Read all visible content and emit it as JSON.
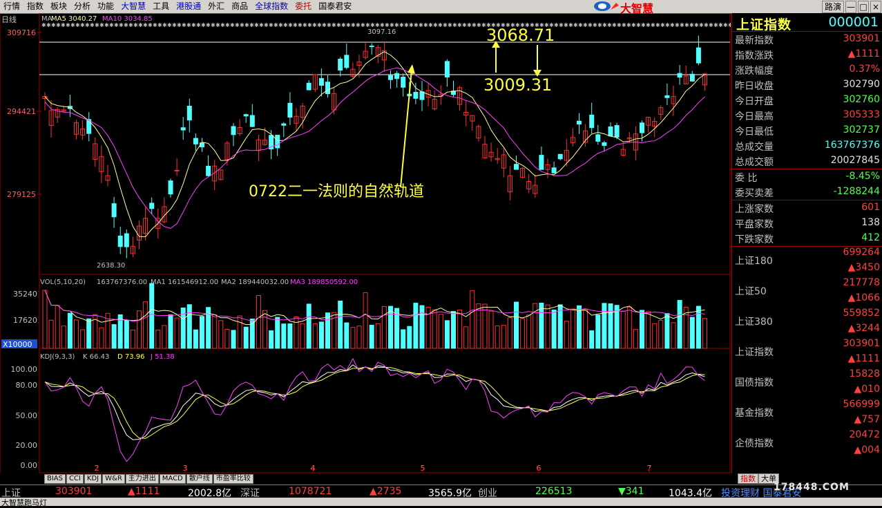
{
  "menu": [
    "行情",
    "指数",
    "板块",
    "分析",
    "功能",
    "大智慧",
    "工具",
    "港股通",
    "外汇",
    "商品",
    "全球指数",
    "委托",
    "国泰君安"
  ],
  "logo_text": "大智慧",
  "window_buttons": [
    "路演",
    "—",
    "□",
    "×"
  ],
  "kline": {
    "mode_label": "日线",
    "ma_legend": {
      "ma": "MA",
      "ma5": "MA5 3040.27",
      "ma10": "MA10 3034.85"
    },
    "y_ticks": [
      "309716",
      "294421",
      "279125"
    ],
    "high_label": "3097.16",
    "low_label": "2638.30",
    "annot_upper": "3068.71",
    "annot_lower": "3009.31",
    "annot_text": "0722二一法则的自然轨道",
    "colors": {
      "up": "#ff3030",
      "down": "#50ffff",
      "ma5": "#ffffa0",
      "ma10": "#ff40ff",
      "annot": "#ffff40"
    }
  },
  "volume": {
    "legend": "VOL(5,10,20)",
    "v": "163767376.00",
    "ma1": "MA1 161546912.00",
    "ma2": "MA2 189440032.00",
    "ma3": "MA3 189850592.00",
    "y_ticks": [
      "35240",
      "17620"
    ],
    "unit": "X10000"
  },
  "kdj": {
    "legend": "KDJ(9,3,3)",
    "k": "K 66.43",
    "d": "D 73.96",
    "j": "J 51.38",
    "y_ticks": [
      "100.00",
      "80.00",
      "50.00",
      "20.00",
      "0.00"
    ]
  },
  "x_ticks": [
    "2",
    "3",
    "4",
    "5",
    "6",
    "7"
  ],
  "indicator_tabs": [
    "BIAS",
    "CCI",
    "KDJ",
    "W&R",
    "主力进出",
    "MACD",
    "散户线",
    "市盈率比较"
  ],
  "panel": {
    "title": "上证指数",
    "code": "000001",
    "rows1": [
      {
        "label": "最新指数",
        "value": "303901",
        "color": "r"
      },
      {
        "label": "指数涨跌",
        "value": "▲1111",
        "color": "r"
      },
      {
        "label": "涨跌幅度",
        "value": "0.37%",
        "color": "r"
      },
      {
        "label": "昨日收盘",
        "value": "302790",
        "color": "w"
      },
      {
        "label": "今日开盘",
        "value": "302760",
        "color": "g"
      },
      {
        "label": "今日最高",
        "value": "305333",
        "color": "r"
      },
      {
        "label": "今日最低",
        "value": "302737",
        "color": "g"
      },
      {
        "label": "总成交量",
        "value": "163767376",
        "color": "c"
      },
      {
        "label": "总成交额",
        "value": "20027845",
        "color": "w"
      }
    ],
    "rows2": [
      {
        "label": "委    比",
        "value": "-8.45%",
        "color": "g"
      },
      {
        "label": "委买卖差",
        "value": "-1288244",
        "color": "g"
      }
    ],
    "rows3": [
      {
        "label": "上涨家数",
        "value": "601",
        "color": "r"
      },
      {
        "label": "平盘家数",
        "value": "138",
        "color": "w"
      },
      {
        "label": "下跌家数",
        "value": "412",
        "color": "g"
      }
    ],
    "indices": [
      {
        "label": "上证180",
        "v1": "699264",
        "v2": "▲3450"
      },
      {
        "label": "上证50",
        "v1": "217778",
        "v2": "▲1066"
      },
      {
        "label": "上证380",
        "v1": "559852",
        "v2": "▲3244"
      },
      {
        "label": "上证指数",
        "v1": "303901",
        "v2": "▲1111"
      },
      {
        "label": "国债指数",
        "v1": "15828",
        "v2": "▲010"
      },
      {
        "label": "基金指数",
        "v1": "566999",
        "v2": "▲757"
      },
      {
        "label": "企债指数",
        "v1": "20472",
        "v2": "▲004"
      }
    ],
    "tabs": [
      "指数",
      "大单"
    ]
  },
  "ticker": {
    "sh_label": "上证",
    "sh_value": "303901",
    "sh_change": "▲1111",
    "sh_amount": "2002.8亿",
    "sz_label": "深证",
    "sz_value": "1078721",
    "sz_change": "▲2735",
    "sz_amount": "3565.9亿",
    "cy_label": "创业",
    "cy_value": "226513",
    "cy_change": "▼341",
    "cy_amount": "1043.4亿",
    "scroll_text": "投资理财  国泰君安"
  },
  "status_text": "大智慧跑马灯",
  "watermark": "178448.COM"
}
